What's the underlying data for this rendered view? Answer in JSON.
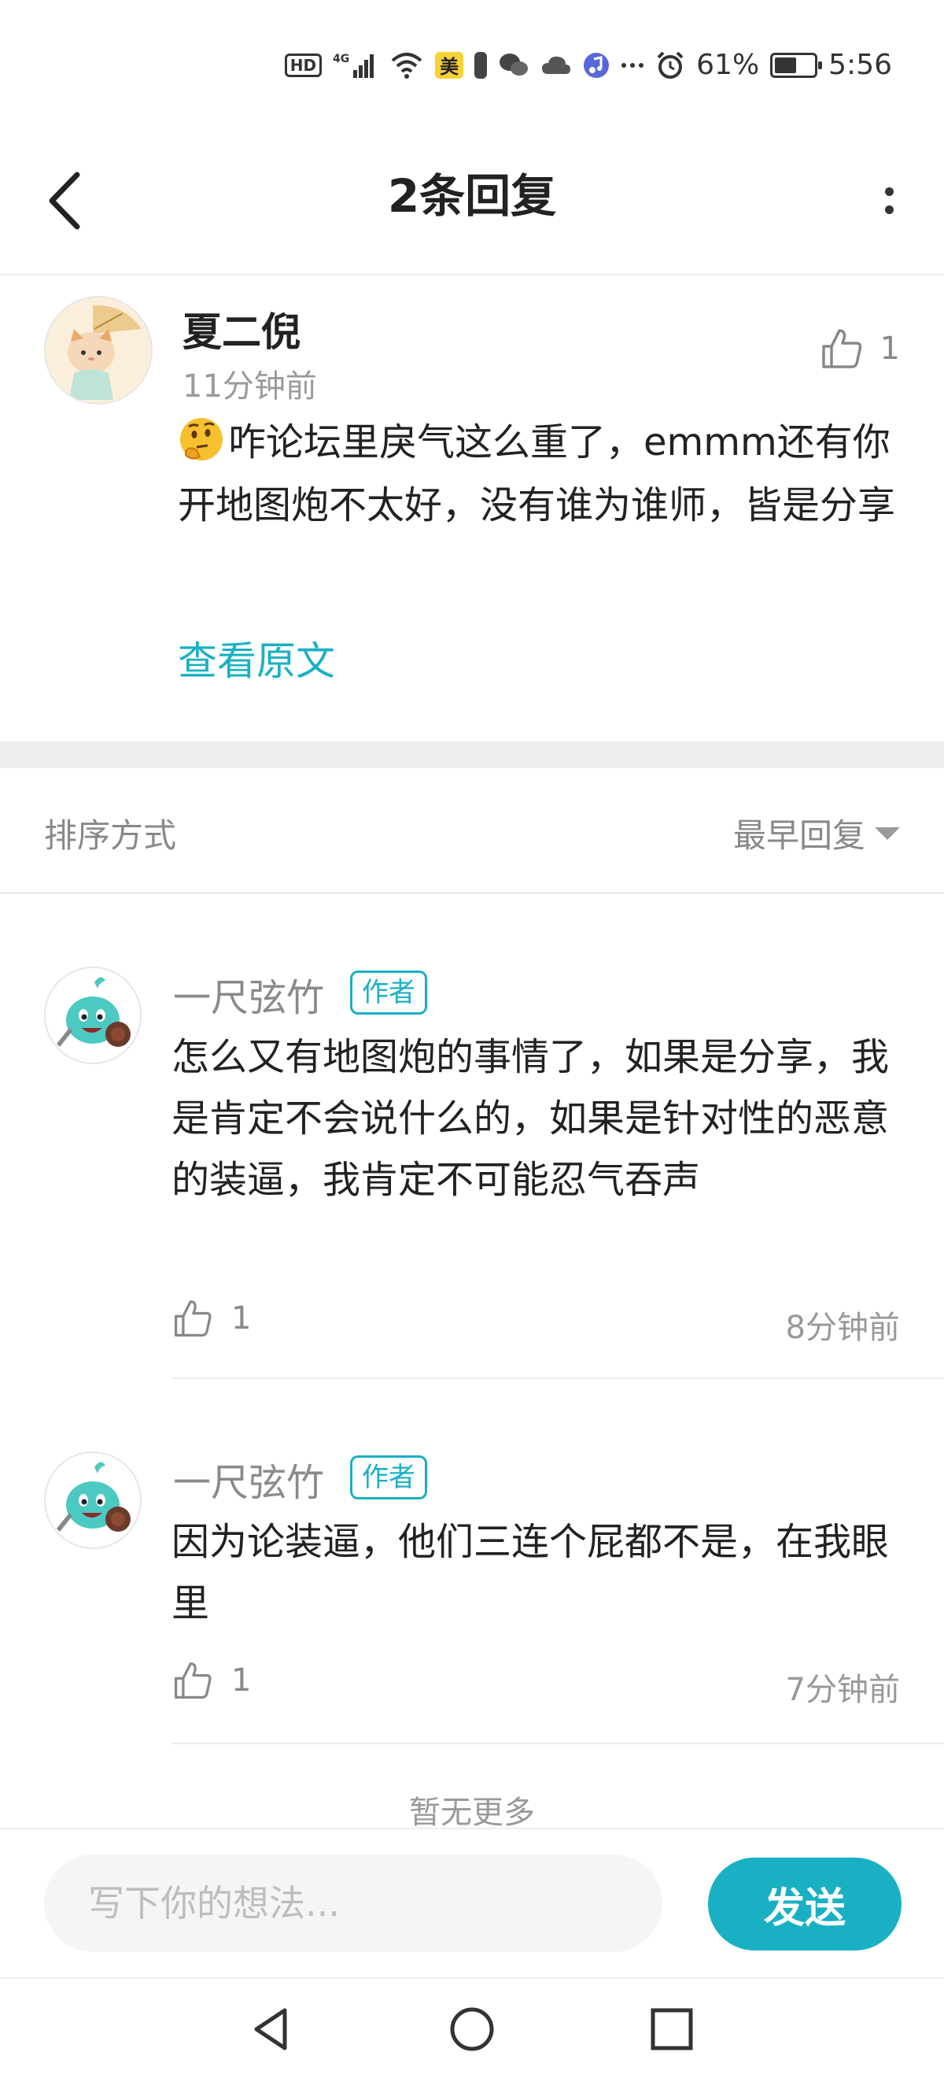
{
  "status_bar": {
    "hd": "HD",
    "network": "4G",
    "meituan_badge": "美",
    "battery_percent": "61%",
    "time": "5:56",
    "battery_level": 0.61,
    "icons": [
      "hd-icon",
      "signal-icon",
      "wifi-icon",
      "meituan-icon",
      "battery-saver-icon",
      "wechat-icon",
      "cloud-icon",
      "music-icon",
      "more-notifications-icon",
      "alarm-icon",
      "battery-icon"
    ]
  },
  "header": {
    "title": "2条回复"
  },
  "original_post": {
    "author": "夏二倪",
    "time": "11分钟前",
    "like_count": "1",
    "content": "咋论坛里戾气这么重了，emmm还有你开地图炮不太好，没有谁为谁师，皆是分享",
    "view_original": "查看原文"
  },
  "sort": {
    "label": "排序方式",
    "value": "最早回复"
  },
  "replies": [
    {
      "author": "一尺弦竹",
      "tag": "作者",
      "content": "怎么又有地图炮的事情了，如果是分享，我是肯定不会说什么的，如果是针对性的恶意的装逼，我肯定不可能忍气吞声",
      "like_count": "1",
      "time": "8分钟前"
    },
    {
      "author": "一尺弦竹",
      "tag": "作者",
      "content": "因为论装逼，他们三连个屁都不是，在我眼里",
      "like_count": "1",
      "time": "7分钟前"
    }
  ],
  "no_more": "暂无更多",
  "composer": {
    "placeholder": "写下你的想法...",
    "value": "",
    "send_label": "发送"
  },
  "colors": {
    "accent": "#1ab0c3",
    "divider": "#eeeeee"
  }
}
